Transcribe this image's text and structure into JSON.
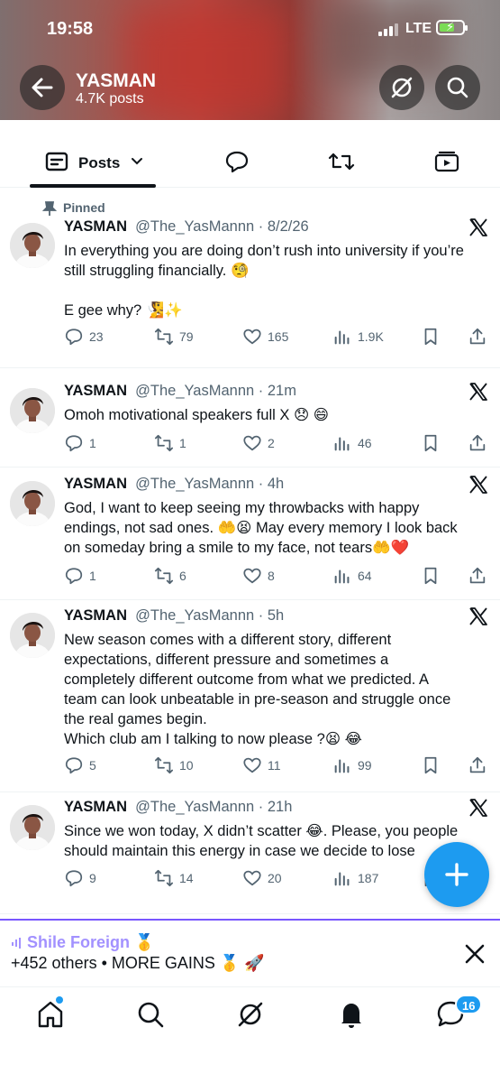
{
  "status": {
    "time": "19:58",
    "network": "LTE"
  },
  "profile": {
    "name": "YASMAN",
    "posts": "4.7K posts"
  },
  "tabs": {
    "posts_label": "Posts"
  },
  "pinned_label": "Pinned",
  "posts": [
    {
      "name": "YASMAN",
      "handle": "@The_YasMannn · 8/2/26",
      "lines": [
        "In everything you are doing don’t rush into university if you’re",
        "still struggling financially. 🧐",
        "",
        "E gee why? 🧏✨"
      ],
      "replies": "23",
      "reposts": "79",
      "likes": "165",
      "views": "1.9K"
    },
    {
      "name": "YASMAN",
      "handle": "@The_YasMannn · 21m",
      "lines": [
        "Omoh motivational speakers full X 😞 😄"
      ],
      "replies": "1",
      "reposts": "1",
      "likes": "2",
      "views": "46"
    },
    {
      "name": "YASMAN",
      "handle": "@The_YasMannn · 4h",
      "lines": [
        "God, I want to keep seeing my throwbacks with happy",
        "endings, not sad ones. 🤲😫  May every memory I look back",
        "on someday bring a smile to my face, not tears🤲❤️"
      ],
      "replies": "1",
      "reposts": "6",
      "likes": "8",
      "views": "64"
    },
    {
      "name": "YASMAN",
      "handle": "@The_YasMannn · 5h",
      "lines": [
        "New season comes with a different story, different",
        "expectations, different pressure and sometimes a",
        "completely different outcome from what we predicted. A",
        "team can look unbeatable in pre-season and struggle once",
        "the real games begin.",
        "Which club am I talking to now please ?😫 😂"
      ],
      "replies": "5",
      "reposts": "10",
      "likes": "11",
      "views": "99"
    },
    {
      "name": "YASMAN",
      "handle": "@The_YasMannn · 21h",
      "lines": [
        "Since we won today, X didn’t scatter 😂. Please, you people",
        "should maintain this energy in case we decide to lose"
      ],
      "replies": "9",
      "reposts": "14",
      "likes": "20",
      "views": "187"
    }
  ],
  "space": {
    "title": "Shile Foreign 🥇",
    "subtitle": "+452 others • MORE GAINS 🥇 🚀"
  },
  "nav": {
    "messages_badge": "16"
  },
  "colors": {
    "accent": "#1d9bf0",
    "space_purple": "#7856ff"
  }
}
